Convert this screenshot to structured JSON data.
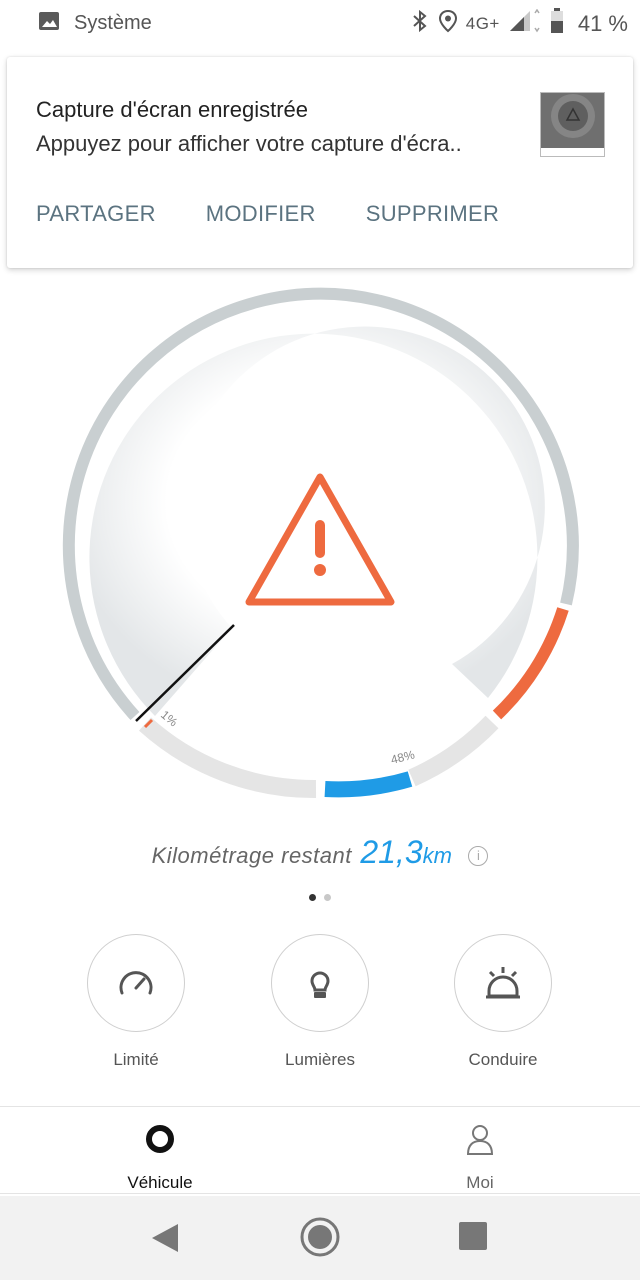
{
  "status_bar": {
    "app_name": "Système",
    "network": "4G+",
    "battery": "41 %",
    "icons": [
      "image-icon",
      "bluetooth-icon",
      "location-icon",
      "signal-icon",
      "battery-icon"
    ]
  },
  "notification": {
    "title": "Capture d'écran enregistrée",
    "text": "Appuyez pour afficher votre capture d'écra..",
    "actions": [
      "PARTAGER",
      "MODIFIER",
      "SUPPRIMER"
    ]
  },
  "gauge": {
    "left_marker": "1%",
    "right_marker": "48%",
    "warning_icon": "warning-triangle-icon",
    "colors": {
      "track": "#c9cfd1",
      "warning": "#ee6a3f",
      "charge": "#1f9be6",
      "needle": "#111111"
    }
  },
  "range": {
    "label": "Kilométrage restant",
    "value": "21,3",
    "unit": "km"
  },
  "pager": {
    "count": 2,
    "active": 0
  },
  "quick_actions": [
    {
      "label": "Limité",
      "icon": "speedometer-icon"
    },
    {
      "label": "Lumières",
      "icon": "bulb-icon"
    },
    {
      "label": "Conduire",
      "icon": "dashboard-light-icon"
    }
  ],
  "tabs": [
    {
      "label": "Véhicule",
      "icon": "vehicle-icon",
      "active": true
    },
    {
      "label": "Moi",
      "icon": "person-icon",
      "active": false
    }
  ],
  "nav_bar": {
    "buttons": [
      "back-icon",
      "home-icon",
      "recents-icon"
    ]
  }
}
